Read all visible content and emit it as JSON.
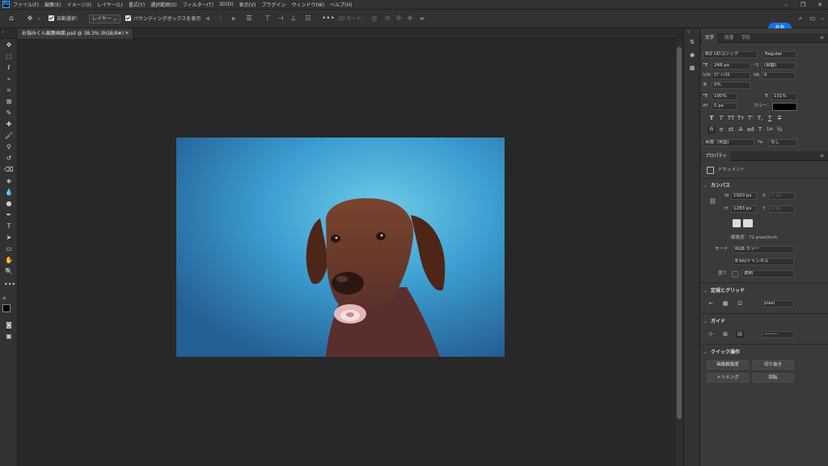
{
  "app": {
    "logo": "Ps"
  },
  "menu": [
    "ファイル(F)",
    "編集(E)",
    "イメージ(I)",
    "レイヤー(L)",
    "書式(Y)",
    "選択範囲(S)",
    "フィルター(T)",
    "3D(D)",
    "表示(V)",
    "プラグイン",
    "ウィンドウ(W)",
    "ヘルプ(H)"
  ],
  "options": {
    "auto_select": "自動選択：",
    "layer_select": "レイヤー",
    "bounding_box": "バウンディングボックスを表示",
    "mode_3d": "3D モード：",
    "share": "共有"
  },
  "document": {
    "tab_title": "お悩みくん編集画面.psd @ 38.3% (RGB/8#) *",
    "close": "×"
  },
  "character": {
    "tabs": [
      "文字",
      "段落",
      "字形"
    ],
    "font_family": "BIZ UDゴシック",
    "font_style": "Regular",
    "font_size": "248 px",
    "leading": "(自動)",
    "kerning": "ｵﾌﾟﾃｨｶﾙ",
    "tracking": "0",
    "tsume": "0%",
    "vscale": "100%",
    "hscale": "101%",
    "baseline": "0 px",
    "color_label": "カラー：",
    "styles": [
      "T",
      "T",
      "TT",
      "Tт",
      "T'",
      "T,",
      "T",
      "T"
    ],
    "opentype": [
      "fi",
      "σ",
      "st",
      "A",
      "ad",
      "T",
      "1st",
      "½"
    ],
    "language": "英語（米国）",
    "aa_label": "ªa",
    "aa": "なし",
    "color_swatch": "#000000"
  },
  "properties": {
    "tab": "プロパティ",
    "doc_label": "ドキュメント",
    "canvas_title": "カンバス",
    "w_label": "W",
    "w": "1920 px",
    "x_label": "X",
    "x_ph": "0 px",
    "h_label": "H",
    "h": "1283 px",
    "y_label": "Y",
    "y_ph": "0 px",
    "resolution": "解像度：72 pixel/inch",
    "mode_label": "モード",
    "mode": "RGB カラー",
    "depth": "8 bit/チャンネル",
    "fill_label": "塗り",
    "fill": "透明",
    "rulers_title": "定規とグリッド",
    "unit": "pixel",
    "guides_title": "ガイド",
    "quick_title": "クイック操作",
    "btn_resize": "画像解像度",
    "btn_crop": "切り抜き",
    "btn_trim": "トリミング",
    "btn_rotate": "回転"
  },
  "colors": {
    "accent": "#1473e6",
    "panel": "#3a3a3a",
    "canvas": "#282828"
  }
}
